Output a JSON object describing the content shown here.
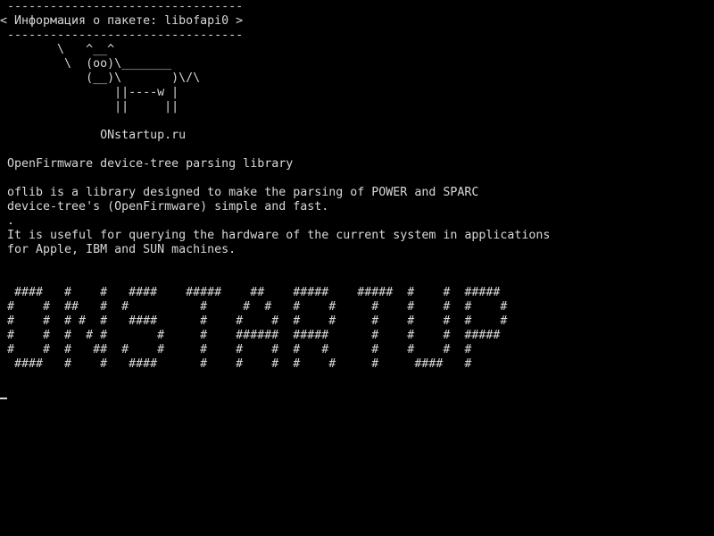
{
  "screen": {
    "lines": [
      " ---------------------------------",
      "< Информация о пакете: libofapi0 >",
      " ---------------------------------",
      "        \\   ^__^",
      "         \\  (oo)\\_______",
      "            (__)\\       )\\/\\",
      "                ||----w |",
      "                ||     ||",
      "",
      "              ONstartup.ru",
      "",
      " OpenFirmware device-tree parsing library",
      "",
      " oflib is a library designed to make the parsing of POWER and SPARC",
      " device-tree's (OpenFirmware) simple and fast.",
      " .",
      " It is useful for querying the hardware of the current system in applications",
      " for Apple, IBM and SUN machines.",
      "",
      "",
      "  ####   #    #   ####    #####    ##    #####    #####  #    #  #####",
      " #    #  ##   #  #          #     #  #   #    #     #    #    #  #    #",
      " #    #  # #  #   ####      #    #    #  #    #     #    #    #  #    #",
      " #    #  #  # #       #     #    ######  #####      #    #    #  #####",
      " #    #  #   ##  #    #     #    #    #  #   #      #    #    #  #",
      "  ####   #    #   ####      #    #    #  #    #     #     ####   #"
    ]
  },
  "colors": {
    "background": "#000000",
    "foreground": "#d8d8d8"
  }
}
